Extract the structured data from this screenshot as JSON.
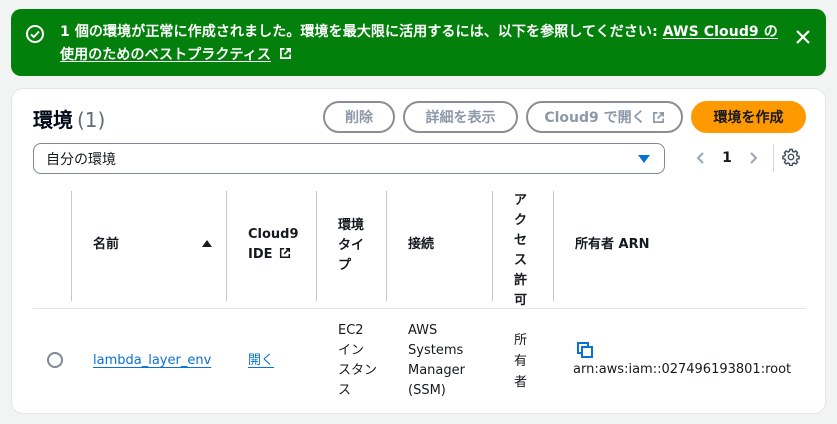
{
  "flash": {
    "message": "1 個の環境が正常に作成されました。環境を最大限に活用するには、以下を参照してください: ",
    "link": "AWS Cloud9 の使用のためのベストプラクティス",
    "icons": {
      "status": "check-circle-icon",
      "link": "external-link-icon",
      "close": "close-icon"
    },
    "color": "#037f0c"
  },
  "panel": {
    "title": "環境",
    "count": "(1)",
    "buttons": {
      "delete": "削除",
      "details": "詳細を表示",
      "open": "Cloud9 で開く",
      "create": "環境を作成"
    },
    "filter": {
      "value": "自分の環境"
    },
    "pagination": {
      "page": "1"
    }
  },
  "table": {
    "headers": {
      "name": "名前",
      "ide_line1": "Cloud9",
      "ide_line2": "IDE",
      "type_line1": "環境",
      "type_line2": "タイプ",
      "connection": "接続",
      "access": [
        "ア",
        "ク",
        "セ",
        "ス",
        "許",
        "可"
      ],
      "owner": "所有者 ARN"
    },
    "rows": [
      {
        "name": "lambda_layer_env",
        "ide": "開く",
        "type": [
          "EC2",
          "イン",
          "スタン",
          "ス"
        ],
        "connection": [
          "AWS",
          "Systems",
          "Manager",
          "(SSM)"
        ],
        "access": [
          "所",
          "有",
          "者"
        ],
        "owner": "arn:aws:iam::027496193801:root"
      }
    ]
  },
  "colors": {
    "accent": "#0972d3",
    "primary_button": "#ff9900"
  }
}
